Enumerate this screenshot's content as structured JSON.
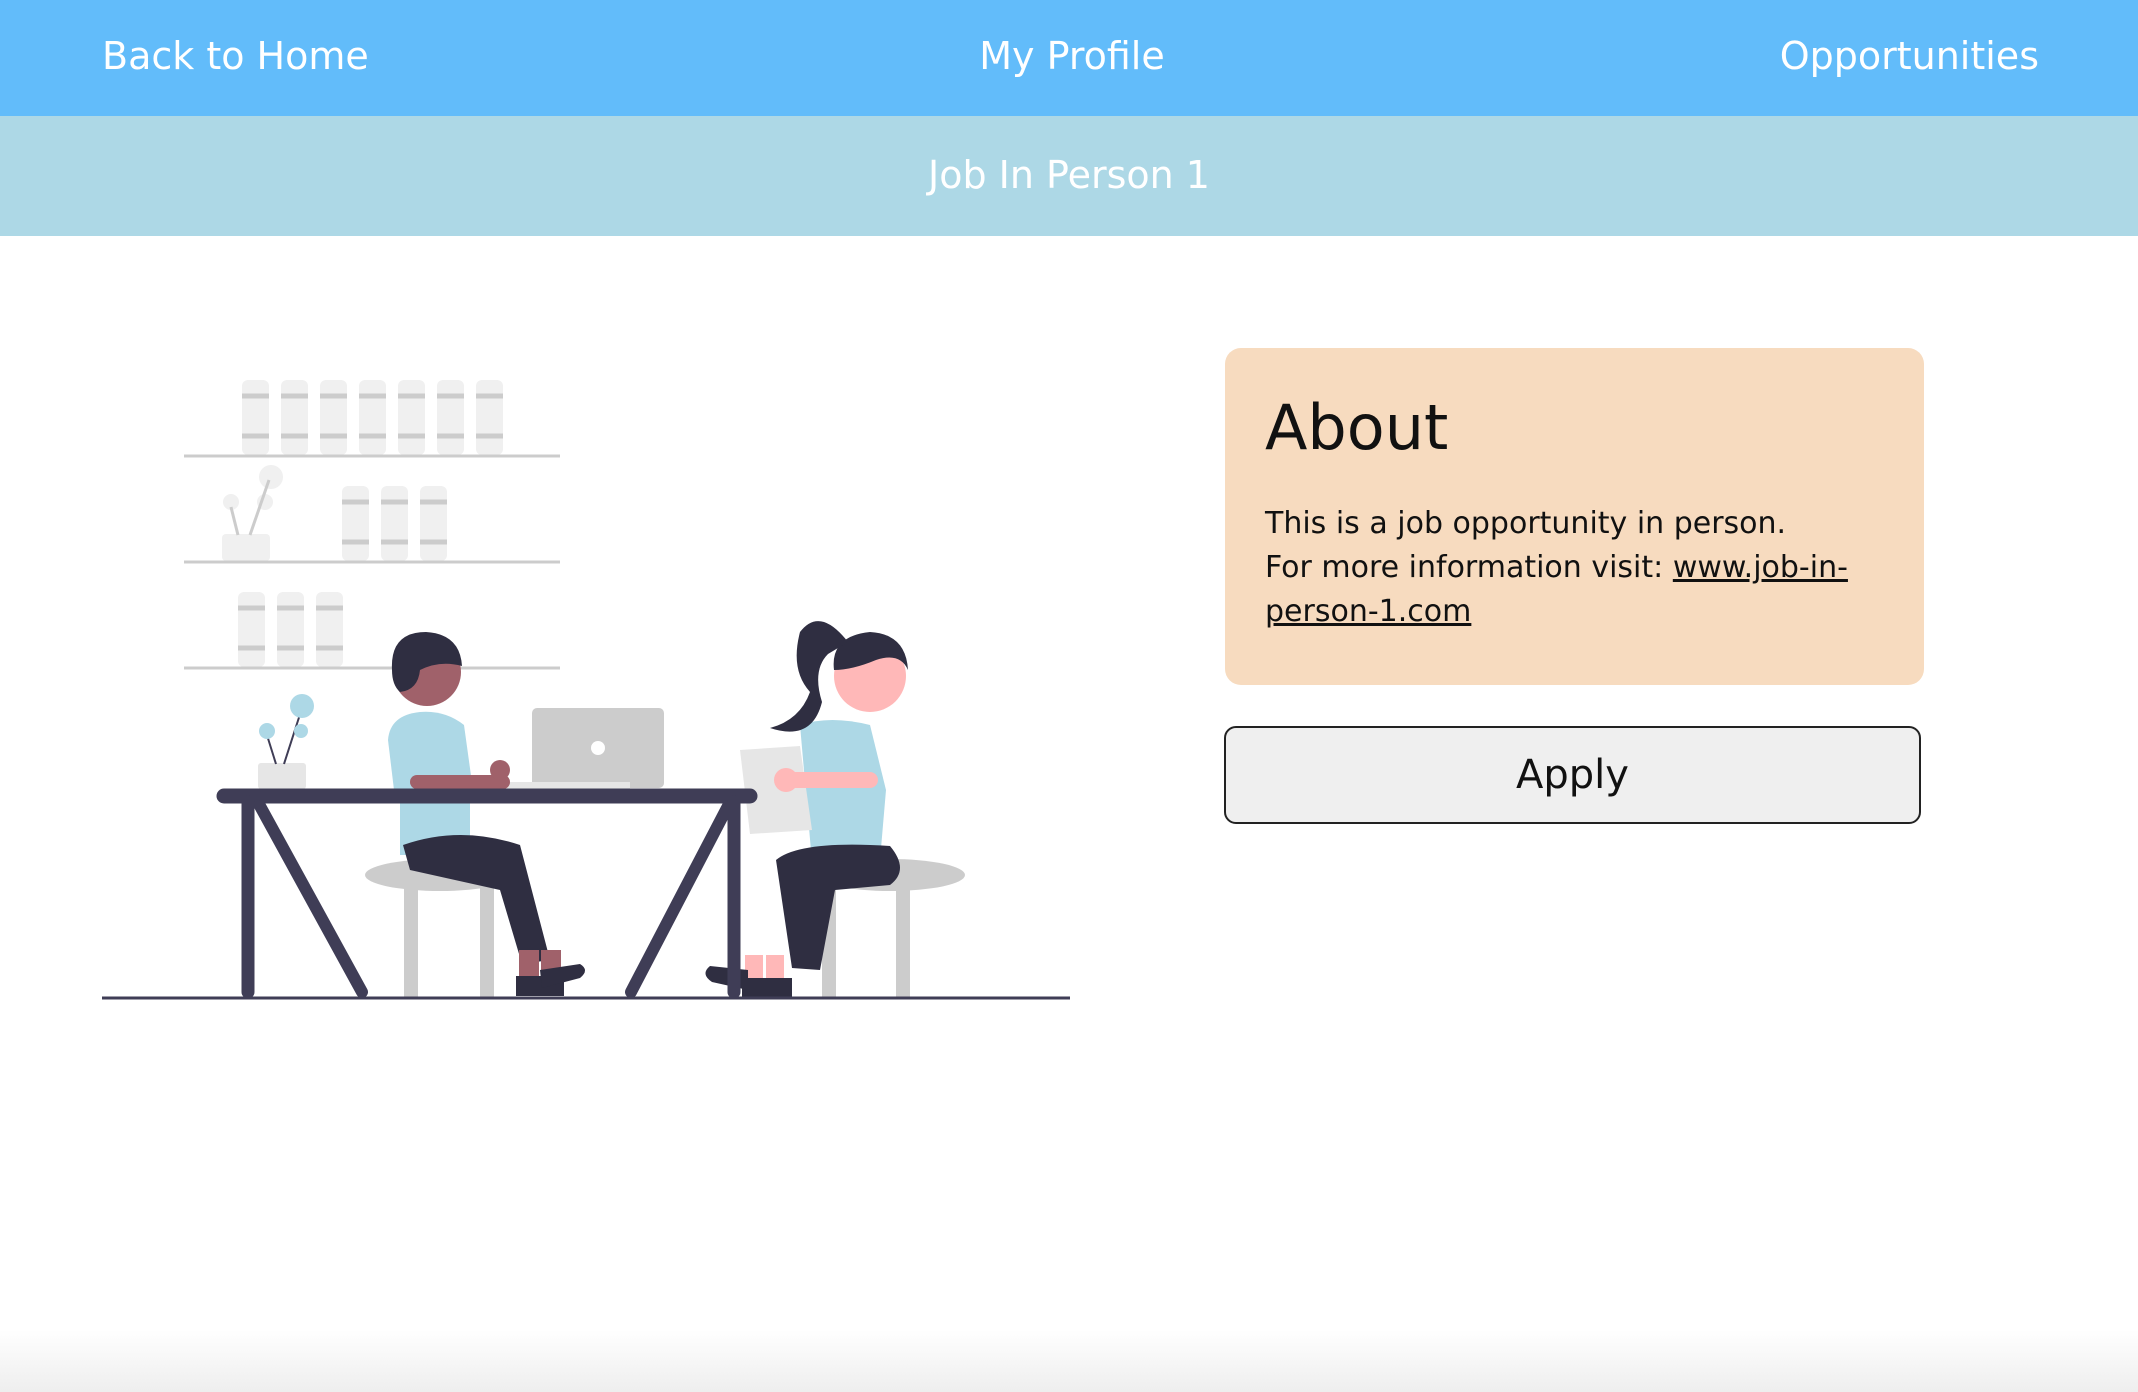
{
  "nav": {
    "home": "Back to Home",
    "profile": "My Profile",
    "opportunities": "Opportunities"
  },
  "page": {
    "title": "Job In Person 1"
  },
  "about": {
    "title": "About",
    "line1": "This is a job opportunity in person.",
    "line2_prefix": "For more information visit: ",
    "link": "www.job-in-person-1.com"
  },
  "actions": {
    "apply": "Apply"
  },
  "colors": {
    "nav_bg": "#62bcfa",
    "subheader_bg": "#add8e6",
    "card_bg": "#f7dbbf",
    "button_bg": "#efefef"
  }
}
